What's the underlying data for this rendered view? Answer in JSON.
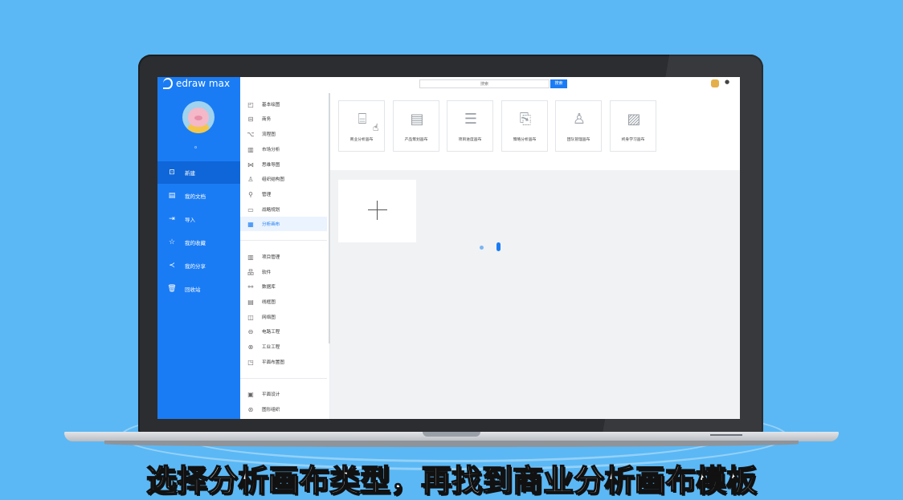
{
  "app": {
    "name": "edraw max"
  },
  "user": {
    "name": "。"
  },
  "sidebar": {
    "items": [
      {
        "label": "新建",
        "icon": "new-file-icon",
        "active": true
      },
      {
        "label": "我的文档",
        "icon": "documents-icon",
        "active": false
      },
      {
        "label": "导入",
        "icon": "import-icon",
        "active": false
      },
      {
        "label": "我的收藏",
        "icon": "star-icon",
        "active": false
      },
      {
        "label": "我的分享",
        "icon": "share-icon",
        "active": false
      },
      {
        "label": "回收站",
        "icon": "trash-icon",
        "active": false
      }
    ]
  },
  "topbar": {
    "search_placeholder": "搜索",
    "search_button": "搜索",
    "menu_dot": "●"
  },
  "categories": {
    "group1": [
      {
        "label": "基本绘图",
        "icon": "basic-drawing-icon"
      },
      {
        "label": "商务",
        "icon": "briefcase-icon"
      },
      {
        "label": "流程图",
        "icon": "flowchart-icon"
      },
      {
        "label": "市场分析",
        "icon": "market-chart-icon"
      },
      {
        "label": "思维导图",
        "icon": "mindmap-icon"
      },
      {
        "label": "组织结构图",
        "icon": "org-chart-icon"
      },
      {
        "label": "管理",
        "icon": "management-icon"
      },
      {
        "label": "战略规划",
        "icon": "strategy-icon"
      },
      {
        "label": "分析画布",
        "icon": "analysis-canvas-icon",
        "active": true
      }
    ],
    "group2": [
      {
        "label": "项目管理",
        "icon": "project-icon"
      },
      {
        "label": "软件",
        "icon": "software-icon"
      },
      {
        "label": "数据库",
        "icon": "database-icon"
      },
      {
        "label": "线框图",
        "icon": "wireframe-icon"
      },
      {
        "label": "网络图",
        "icon": "network-icon"
      },
      {
        "label": "电路工程",
        "icon": "circuit-icon"
      },
      {
        "label": "工业工程",
        "icon": "industrial-icon"
      },
      {
        "label": "平面布置图",
        "icon": "floorplan-icon"
      }
    ],
    "group3": [
      {
        "label": "平面设计",
        "icon": "graphic-design-icon"
      },
      {
        "label": "图形组织",
        "icon": "graphic-organizer-icon"
      }
    ]
  },
  "templates": [
    {
      "name": "商业分析画布",
      "icon": "business-canvas-icon"
    },
    {
      "name": "产品策划画布",
      "icon": "product-plan-icon"
    },
    {
      "name": "项目进度画布",
      "icon": "project-progress-icon"
    },
    {
      "name": "策略分析画布",
      "icon": "strategy-analysis-icon"
    },
    {
      "name": "团队管理画布",
      "icon": "team-management-icon"
    },
    {
      "name": "终身学习画布",
      "icon": "lifelong-learning-icon"
    }
  ],
  "caption": "选择分析画布类型，再找到商业分析画布模板"
}
